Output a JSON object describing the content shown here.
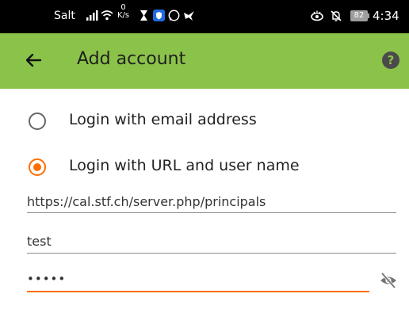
{
  "status_bar": {
    "carrier": "Salt",
    "speed_value": "0",
    "speed_unit": "K/s",
    "battery": "82",
    "time": "4:34"
  },
  "app_bar": {
    "title": "Add account",
    "back_icon": "arrow-left-icon",
    "help_icon": "help-circle-icon",
    "background_color": "#8bc34a"
  },
  "login_options": [
    {
      "label": "Login with email address",
      "selected": false
    },
    {
      "label": "Login with URL and user name",
      "selected": true
    }
  ],
  "form": {
    "base_url": "https://cal.stf.ch/server.php/principals",
    "user_name": "test",
    "password": "•••••",
    "password_visibility_icon": "visibility-off-icon"
  },
  "accent_color": "#ff6d00"
}
